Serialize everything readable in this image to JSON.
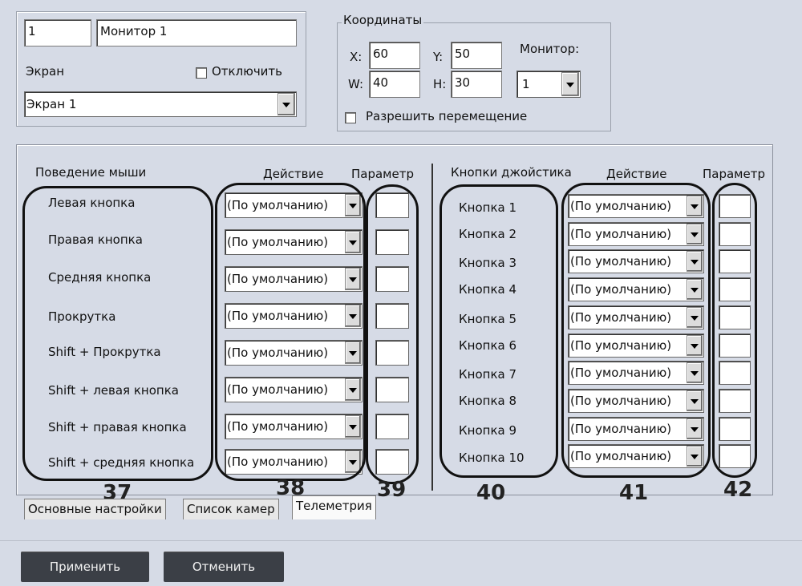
{
  "monitor": {
    "id": "1",
    "name": "Монитор 1"
  },
  "screen": {
    "label": "Экран",
    "disable_label": "Отключить",
    "selected": "Экран 1"
  },
  "coords": {
    "title": "Координаты",
    "x_label": "X:",
    "x": "60",
    "y_label": "Y:",
    "y": "50",
    "w_label": "W:",
    "w": "40",
    "h_label": "H:",
    "h": "30",
    "monitor_label": "Монитор:",
    "monitor_value": "1",
    "allow_move_label": "Разрешить перемещение"
  },
  "mouse": {
    "header": "Поведение мыши",
    "action_header": "Действие",
    "param_header": "Параметр",
    "rows": [
      "Левая кнопка",
      "Правая кнопка",
      "Средняя кнопка",
      "Прокрутка",
      "Shift + Прокрутка",
      "Shift + левая кнопка",
      "Shift + правая кнопка",
      "Shift + средняя кнопка"
    ],
    "default_action": "(По умолчанию)"
  },
  "joystick": {
    "header": "Кнопки джойстика",
    "action_header": "Действие",
    "param_header": "Параметр",
    "rows": [
      "Кнопка 1",
      "Кнопка 2",
      "Кнопка 3",
      "Кнопка 4",
      "Кнопка 5",
      "Кнопка 6",
      "Кнопка 7",
      "Кнопка 8",
      "Кнопка 9",
      "Кнопка 10"
    ],
    "default_action": "(По умолчанию)"
  },
  "annotations": [
    "37",
    "38",
    "39",
    "40",
    "41",
    "42"
  ],
  "tabs": [
    "Основные настройки",
    "Список камер",
    "Телеметрия"
  ],
  "buttons": {
    "apply": "Применить",
    "cancel": "Отменить"
  }
}
